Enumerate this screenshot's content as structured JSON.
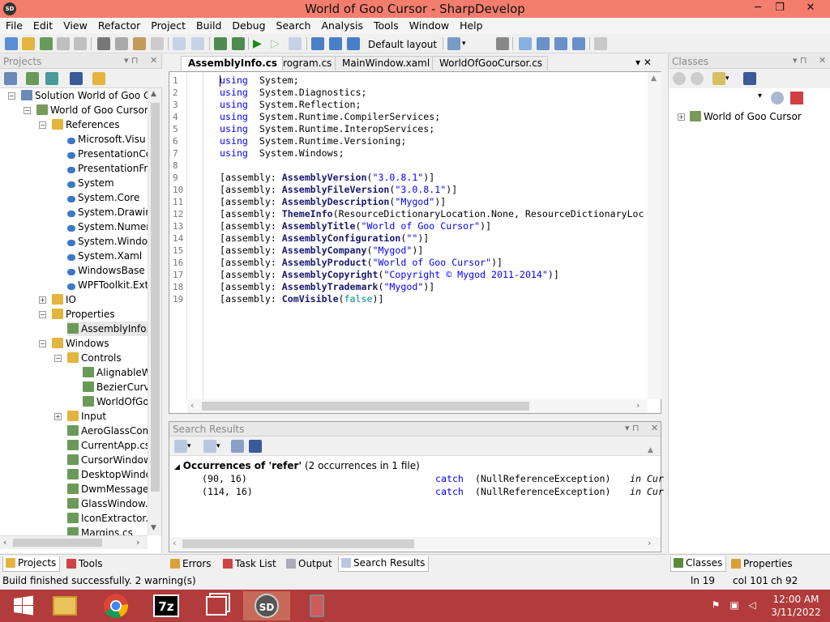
{
  "window": {
    "title": "World of Goo Cursor - SharpDevelop",
    "icon_label": "SD",
    "controls": [
      "─",
      "❐",
      "✕"
    ]
  },
  "menu": [
    "File",
    "Edit",
    "View",
    "Refactor",
    "Project",
    "Build",
    "Debug",
    "Search",
    "Analysis",
    "Tools",
    "Window",
    "Help"
  ],
  "toolbar": {
    "layout_label": "Default layout",
    "dropdown_arrow": "▾"
  },
  "projects_panel": {
    "title": "Projects",
    "pin": "▾ ⊓",
    "close": "✕",
    "tree": [
      {
        "label": "Solution World of Goo Cu",
        "indent": 0,
        "exp": "−"
      },
      {
        "label": "World of Goo Cursor",
        "indent": 1,
        "exp": "−"
      },
      {
        "label": "References",
        "indent": 2,
        "exp": "−"
      },
      {
        "label": "Microsoft.Visu",
        "indent": 3,
        "exp": ""
      },
      {
        "label": "PresentationCo",
        "indent": 3,
        "exp": ""
      },
      {
        "label": "PresentationFr",
        "indent": 3,
        "exp": ""
      },
      {
        "label": "System",
        "indent": 3,
        "exp": ""
      },
      {
        "label": "System.Core",
        "indent": 3,
        "exp": ""
      },
      {
        "label": "System.Drawin",
        "indent": 3,
        "exp": ""
      },
      {
        "label": "System.Numer",
        "indent": 3,
        "exp": ""
      },
      {
        "label": "System.Windo",
        "indent": 3,
        "exp": ""
      },
      {
        "label": "System.Xaml",
        "indent": 3,
        "exp": ""
      },
      {
        "label": "WindowsBase",
        "indent": 3,
        "exp": ""
      },
      {
        "label": "WPFToolkit.Ext",
        "indent": 3,
        "exp": ""
      },
      {
        "label": "IO",
        "indent": 2,
        "exp": "+"
      },
      {
        "label": "Properties",
        "indent": 2,
        "exp": "−"
      },
      {
        "label": "AssemblyInfo.c",
        "indent": 3,
        "exp": ""
      },
      {
        "label": "Windows",
        "indent": 2,
        "exp": "−"
      },
      {
        "label": "Controls",
        "indent": 3,
        "exp": "−"
      },
      {
        "label": "AlignableW",
        "indent": 4,
        "exp": ""
      },
      {
        "label": "BezierCurv",
        "indent": 4,
        "exp": ""
      },
      {
        "label": "WorldOfGo",
        "indent": 4,
        "exp": ""
      },
      {
        "label": "Input",
        "indent": 3,
        "exp": "+"
      },
      {
        "label": "AeroGlassCom",
        "indent": 3,
        "exp": ""
      },
      {
        "label": "CurrentApp.cs",
        "indent": 3,
        "exp": ""
      },
      {
        "label": "CursorWindow",
        "indent": 3,
        "exp": ""
      },
      {
        "label": "DesktopWindo",
        "indent": 3,
        "exp": ""
      },
      {
        "label": "DwmMessages",
        "indent": 3,
        "exp": ""
      },
      {
        "label": "GlassWindow.c",
        "indent": 3,
        "exp": ""
      },
      {
        "label": "IconExtractor.c",
        "indent": 3,
        "exp": ""
      },
      {
        "label": "Margins.cs",
        "indent": 3,
        "exp": ""
      }
    ],
    "tabs": [
      "Projects",
      "Tools"
    ]
  },
  "doc_tabs": [
    "AssemblyInfo.cs",
    "Program.cs",
    "MainWindow.xaml",
    "WorldOfGooCursor.cs"
  ],
  "doc_tabs_controls": "▾ ✕",
  "editor": {
    "line_numbers": [
      "1",
      "2",
      "3",
      "4",
      "5",
      "6",
      "7",
      "8",
      "9",
      "10",
      "11",
      "12",
      "13",
      "14",
      "15",
      "16",
      "17",
      "18",
      "19"
    ],
    "lines": [
      [
        [
          "kw",
          "using"
        ],
        [
          "",
          "  System;"
        ]
      ],
      [
        [
          "kw",
          "using"
        ],
        [
          "",
          "  System.Diagnostics;"
        ]
      ],
      [
        [
          "kw",
          "using"
        ],
        [
          "",
          "  System.Reflection;"
        ]
      ],
      [
        [
          "kw",
          "using"
        ],
        [
          "",
          "  System.Runtime.CompilerServices;"
        ]
      ],
      [
        [
          "kw",
          "using"
        ],
        [
          "",
          "  System.Runtime.InteropServices;"
        ]
      ],
      [
        [
          "kw",
          "using"
        ],
        [
          "",
          "  System.Runtime.Versioning;"
        ]
      ],
      [
        [
          "kw",
          "using"
        ],
        [
          "",
          "  System.Windows;"
        ]
      ],
      [],
      [
        [
          "",
          "[assembly: "
        ],
        [
          "fn",
          "AssemblyVersion"
        ],
        [
          "",
          "("
        ],
        [
          "str",
          "\"3.0.8.1\""
        ],
        [
          "",
          ")]"
        ]
      ],
      [
        [
          "",
          "[assembly: "
        ],
        [
          "fn",
          "AssemblyFileVersion"
        ],
        [
          "",
          "("
        ],
        [
          "str",
          "\"3.0.8.1\""
        ],
        [
          "",
          ")]"
        ]
      ],
      [
        [
          "",
          "[assembly: "
        ],
        [
          "fn",
          "AssemblyDescription"
        ],
        [
          "",
          "("
        ],
        [
          "str",
          "\"Mygod\""
        ],
        [
          "",
          ")]"
        ]
      ],
      [
        [
          "",
          "[assembly: "
        ],
        [
          "fn",
          "ThemeInfo"
        ],
        [
          "",
          "(ResourceDictionaryLocation.None, ResourceDictionaryLoc"
        ]
      ],
      [
        [
          "",
          "[assembly: "
        ],
        [
          "fn",
          "AssemblyTitle"
        ],
        [
          "",
          "("
        ],
        [
          "str",
          "\"World of Goo Cursor\""
        ],
        [
          "",
          ")]"
        ]
      ],
      [
        [
          "",
          "[assembly: "
        ],
        [
          "fn",
          "AssemblyConfiguration"
        ],
        [
          "",
          "("
        ],
        [
          "str",
          "\"\""
        ],
        [
          "",
          ")]"
        ]
      ],
      [
        [
          "",
          "[assembly: "
        ],
        [
          "fn",
          "AssemblyCompany"
        ],
        [
          "",
          "("
        ],
        [
          "str",
          "\"Mygod\""
        ],
        [
          "",
          ")]"
        ]
      ],
      [
        [
          "",
          "[assembly: "
        ],
        [
          "fn",
          "AssemblyProduct"
        ],
        [
          "",
          "("
        ],
        [
          "str",
          "\"World of Goo Cursor\""
        ],
        [
          "",
          ")]"
        ]
      ],
      [
        [
          "",
          "[assembly: "
        ],
        [
          "fn",
          "AssemblyCopyright"
        ],
        [
          "",
          "("
        ],
        [
          "str",
          "\"Copyright © Mygod 2011-2014\""
        ],
        [
          "",
          ")]"
        ]
      ],
      [
        [
          "",
          "[assembly: "
        ],
        [
          "fn",
          "AssemblyTrademark"
        ],
        [
          "",
          "("
        ],
        [
          "str",
          "\"Mygod\""
        ],
        [
          "",
          ")]"
        ]
      ],
      [
        [
          "",
          "[assembly: "
        ],
        [
          "fn",
          "ComVisible"
        ],
        [
          "",
          "("
        ],
        [
          "lit",
          "false"
        ],
        [
          "",
          ")]"
        ]
      ]
    ]
  },
  "search_results": {
    "title": "Search Results",
    "header_bold": "Occurrences of 'refer'",
    "header_rest": " (2 occurrences in 1 file)",
    "rows": [
      {
        "pos": "(90, 16)",
        "kw": "catch",
        "code": " (NullReferenceException)",
        "loc": "in Cur"
      },
      {
        "pos": "(114, 16)",
        "kw": "catch",
        "code": " (NullReferenceException)",
        "loc": "in Cur"
      }
    ],
    "bottom_tabs": [
      "Errors",
      "Task List",
      "Output",
      "Search Results"
    ]
  },
  "classes_panel": {
    "title": "Classes",
    "tree": [
      {
        "label": "World of Goo Cursor",
        "exp": "+"
      }
    ],
    "tabs": [
      "Classes",
      "Properties"
    ]
  },
  "status": {
    "message": "Build finished successfully. 2 warning(s)",
    "line": "ln 19",
    "col": "col 101",
    "ch": "ch 92"
  },
  "taskbar": {
    "time": "12:00 AM",
    "date": "3/11/2022",
    "apps": [
      "start",
      "explorer",
      "chrome",
      "7z",
      "windows",
      "sharpdevelop",
      "app"
    ],
    "sevenzip_label": "7z",
    "sd_label": "SD"
  },
  "colors": {
    "titlebar": "#f37e6e",
    "taskbar": "#b23b3b",
    "keyword": "#0000ff",
    "method": "#191970"
  }
}
